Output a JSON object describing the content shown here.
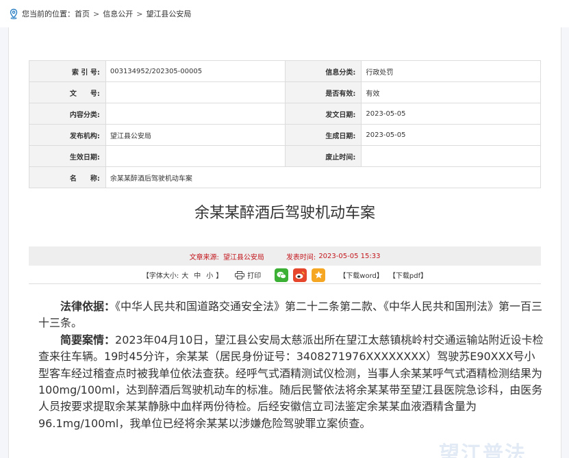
{
  "breadcrumb": {
    "prefix": "您当前的位置：",
    "items": [
      "首页",
      "信息公开",
      "望江县公安局"
    ],
    "separator": ">"
  },
  "meta": {
    "rows": [
      [
        {
          "label": "索 引 号:",
          "value": "003134952/202305-00005"
        },
        {
          "label": "信息分类:",
          "value": "行政处罚"
        }
      ],
      [
        {
          "label": "文　　号:",
          "value": ""
        },
        {
          "label": "是否有效:",
          "value": "有效"
        }
      ],
      [
        {
          "label": "内容分类:",
          "value": ""
        },
        {
          "label": "发文日期:",
          "value": "2023-05-05"
        }
      ],
      [
        {
          "label": "发布机构:",
          "value": "望江县公安局"
        },
        {
          "label": "生成日期:",
          "value": "2023-05-05"
        }
      ],
      [
        {
          "label": "生效日期:",
          "value": ""
        },
        {
          "label": "废止时间:",
          "value": ""
        }
      ]
    ],
    "name_label": "名　　称:",
    "name_value": "余某某醉酒后驾驶机动车案"
  },
  "article": {
    "title": "余某某醉酒后驾驶机动车案",
    "source_label": "文章来源:",
    "source": "望江县公安局",
    "time_label": "发表时间:",
    "time": "2023-05-05 15:33"
  },
  "tools": {
    "font_size_label": "【字体大小:",
    "size_large": "大",
    "size_medium": "中",
    "size_small": "小",
    "font_size_close": "】",
    "print_label": "打印",
    "download_word": "【下载word】",
    "download_pdf": "【下载pdf】"
  },
  "content": {
    "legal_basis_label": "法律依据：",
    "legal_basis": "《中华人民共和国道路交通安全法》第二十二条第二款、《中华人民共和国刑法》第一百三十三条。",
    "summary_label": "简要案情：",
    "summary": "2023年04月10日，望江县公安局太慈派出所在望江太慈镇桃岭村交通运输站附近设卡检查来往车辆。19时45分许，余某某（居民身份证号：3408271976XXXXXXXX）驾驶苏E90XXX号小型客车经过稽查点时被我单位依法查获。经呼气式酒精测试仪检测，当事人余某某呼气式酒精检测结果为100mg/100ml，达到醉酒后驾驶机动车的标准。随后民警依法将余某某带至望江县医院急诊科，由医务人员按要求提取余某某静脉中血样两份待检。后经安徽信立司法鉴定余某某血液酒精含量为96.1mg/100ml，我单位已经将余某某以涉嫌危险驾驶罪立案侦查。"
  },
  "watermark": "望江普法",
  "colors": {
    "accent_red": "#c3161c",
    "wechat": "#3cb034",
    "weibo": "#e6462c",
    "favorite": "#f5a623"
  },
  "icons": [
    "location-pin-icon",
    "printer-icon",
    "wechat-icon",
    "weibo-icon",
    "star-icon"
  ]
}
